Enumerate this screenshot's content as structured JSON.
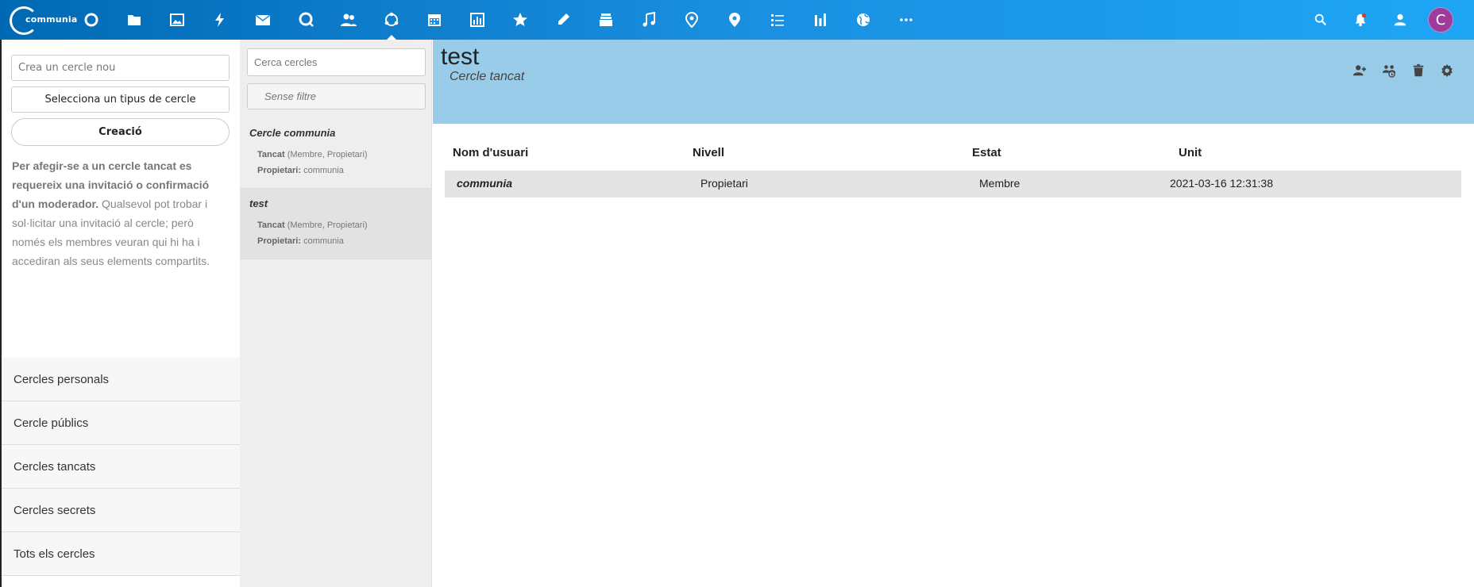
{
  "header": {
    "logo_text": "communia",
    "avatar_letter": "C",
    "app_icons": [
      "dashboard-icon",
      "files-icon",
      "photos-icon",
      "activity-icon",
      "mail-icon",
      "talk-icon",
      "contacts-icon",
      "circles-icon",
      "calendar-icon",
      "analytics-icon",
      "bookmarks-icon",
      "notes-icon",
      "deck-icon",
      "music-icon",
      "maps-poi-icon",
      "maps-icon",
      "tasks-icon",
      "stats-icon",
      "social-icon",
      "more-icon"
    ],
    "right_icons": [
      "search-icon",
      "notifications-icon",
      "contacts-menu-icon"
    ]
  },
  "left": {
    "create_placeholder": "Crea un cercle nou",
    "type_select": "Selecciona un tipus de cercle",
    "create_button": "Creació",
    "info_bold": "Per afegir-se a un cercle tancat es requereix una invitació o confirmació d'un moderador.",
    "info_text": " Qualsevol pot trobar i sol·licitar una invitació al cercle; però només els membres veuran qui hi ha i accediran als seus elements compartits.",
    "nav": [
      "Cercles personals",
      "Cercle públics",
      "Cercles tancats",
      "Cercles secrets",
      "Tots els cercles"
    ]
  },
  "middle": {
    "search_placeholder": "Cerca cercles",
    "filter": "Sense filtre",
    "items": [
      {
        "name": "Cercle communia",
        "type": "Tancat",
        "roles": " (Membre, Propietari)",
        "owner_label": "Propietari:",
        "owner": " communia"
      },
      {
        "name": "test",
        "type": "Tancat",
        "roles": " (Membre, Propietari)",
        "owner_label": "Propietari:",
        "owner": " communia"
      }
    ]
  },
  "main": {
    "title": "test",
    "subtitle": "Cercle tancat",
    "columns": [
      "Nom d'usuari",
      "Nivell",
      "Estat",
      "Unit"
    ],
    "rows": [
      {
        "user": "communia",
        "level": "Propietari",
        "status": "Membre",
        "joined": "2021-03-16 12:31:38"
      }
    ]
  },
  "colors": {
    "header_start": "#0069b4",
    "header_end": "#1ea6f5",
    "banner": "#99cce9",
    "avatar": "#a03b9e"
  }
}
